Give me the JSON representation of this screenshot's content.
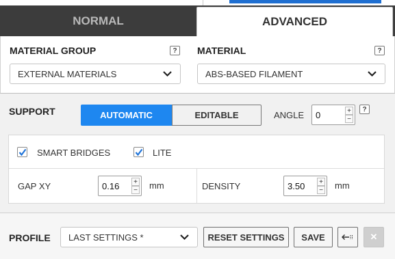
{
  "tabs": [
    {
      "label": "NORMAL",
      "active": false
    },
    {
      "label": "ADVANCED",
      "active": true
    }
  ],
  "material_group": {
    "label": "MATERIAL GROUP",
    "help": "?",
    "value": "EXTERNAL MATERIALS"
  },
  "material": {
    "label": "MATERIAL",
    "help": "?",
    "value": "ABS-BASED FILAMENT"
  },
  "support": {
    "label": "SUPPORT",
    "modes": [
      "AUTOMATIC",
      "EDITABLE"
    ],
    "selected_mode": "AUTOMATIC",
    "angle_label": "ANGLE",
    "angle_value": "0",
    "help": "?",
    "smart_bridges_label": "SMART BRIDGES",
    "smart_bridges_checked": true,
    "lite_label": "LITE",
    "lite_checked": true,
    "gap_xy_label": "GAP XY",
    "gap_xy_value": "0.16",
    "gap_xy_unit": "mm",
    "density_label": "DENSITY",
    "density_value": "3.50",
    "density_unit": "mm",
    "spin_up": "+",
    "spin_down": "−"
  },
  "profile": {
    "label": "PROFILE",
    "value": "LAST SETTINGS *",
    "reset_label": "RESET SETTINGS",
    "save_label": "SAVE",
    "close_glyph": "✕"
  },
  "colors": {
    "accent": "#1e87f0",
    "tab_bar": "#3c3c3c",
    "panel": "#f1f1f1"
  }
}
